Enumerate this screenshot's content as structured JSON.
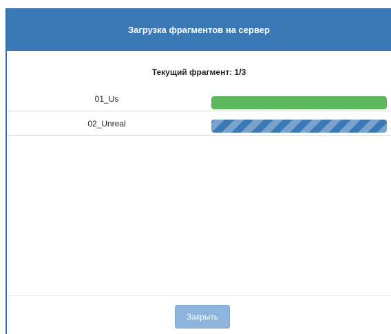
{
  "dialog": {
    "title": "Загрузка фрагментов на сервер",
    "current_fragment": "Текущий фрагмент: 1/3",
    "fragments": [
      {
        "name": "01_Us",
        "progress": 1.0,
        "status": "complete",
        "color": "#5cb85c"
      },
      {
        "name": "02_Unreal",
        "progress": 1.0,
        "status": "in-progress",
        "color": "#3a78b6"
      }
    ],
    "close_label": "Закрыть"
  },
  "colors": {
    "header": "#3a78b6",
    "button": "#8cb4dc"
  }
}
